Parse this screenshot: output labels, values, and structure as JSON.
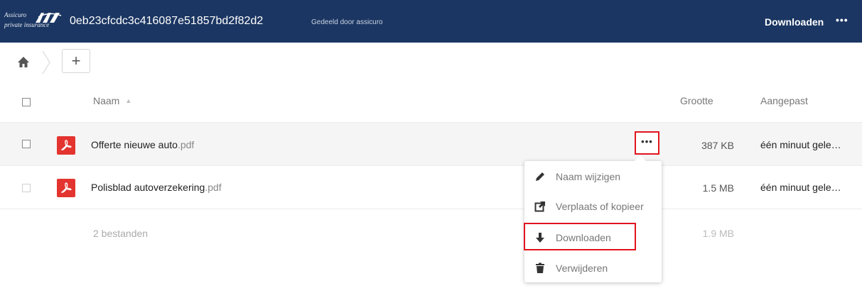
{
  "header": {
    "logo_line1": "Assicuro",
    "logo_line2": "private insurance",
    "share_id": "0eb23cfcdc3c416087e51857bd2f82d2",
    "shared_by": "Gedeeld door assicuro",
    "download_label": "Downloaden",
    "more_label": "•••",
    "background_color": "#1b3662"
  },
  "toolbar": {
    "home_icon": "home-icon",
    "add_label": "+"
  },
  "table": {
    "columns": {
      "name": "Naam",
      "size": "Grootte",
      "modified": "Aangepast"
    },
    "rows": [
      {
        "name": "Offerte nieuwe auto",
        "ext": ".pdf",
        "size": "387 KB",
        "modified": "één minuut gele…",
        "icon": "pdf-icon"
      },
      {
        "name": "Polisblad autoverzekering",
        "ext": ".pdf",
        "size": "1.5 MB",
        "modified": "één minuut gele…",
        "icon": "pdf-icon"
      }
    ],
    "more_label": "•••",
    "summary_count": "2 bestanden",
    "summary_size": "1.9 MB"
  },
  "menu": {
    "items": [
      {
        "label": "Naam wijzigen",
        "icon": "pencil-icon"
      },
      {
        "label": "Verplaats of kopieer",
        "icon": "external-link-icon"
      },
      {
        "label": "Downloaden",
        "icon": "download-arrow-icon"
      },
      {
        "label": "Verwijderen",
        "icon": "trash-icon"
      }
    ]
  },
  "colors": {
    "highlight": "#e1141e",
    "pdf": "#e3342f"
  }
}
